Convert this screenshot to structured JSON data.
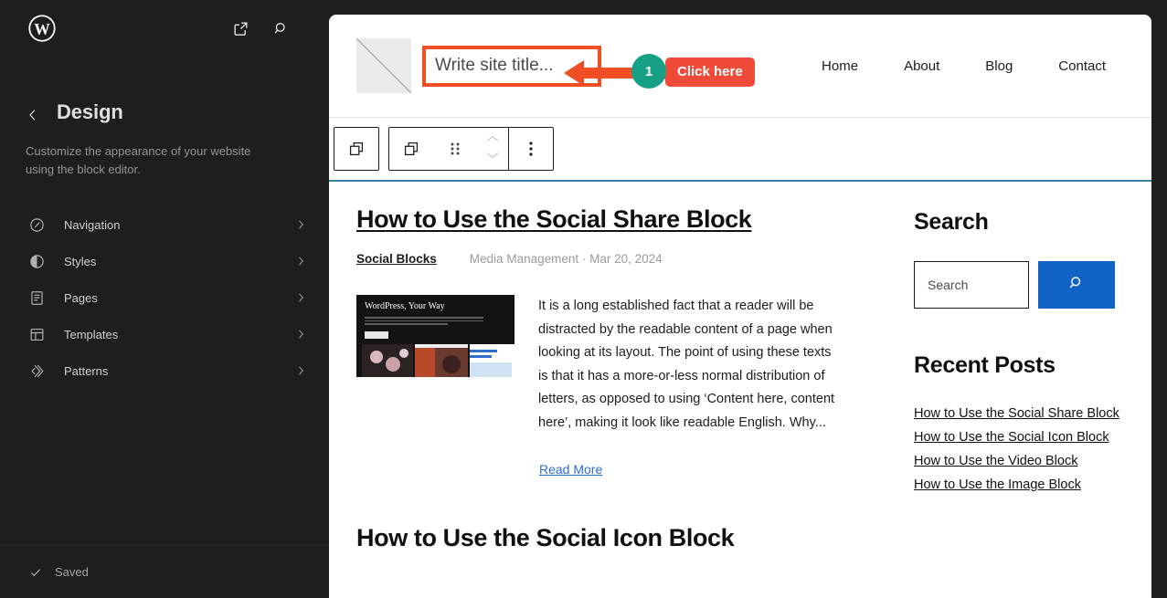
{
  "sidebar": {
    "logo_icon": "wordpress-logo",
    "top_icons": [
      {
        "name": "view-site-icon",
        "label": "View site"
      },
      {
        "name": "search-icon",
        "label": "Search"
      }
    ],
    "back_label": "Back",
    "title": "Design",
    "description": "Customize the appearance of your website using the block editor.",
    "items": [
      {
        "label": "Navigation",
        "icon": "navigation-icon"
      },
      {
        "label": "Styles",
        "icon": "styles-contrast-icon"
      },
      {
        "label": "Pages",
        "icon": "pages-document-icon"
      },
      {
        "label": "Templates",
        "icon": "templates-layout-icon"
      },
      {
        "label": "Patterns",
        "icon": "patterns-stack-icon"
      }
    ],
    "footer": {
      "status": "Saved",
      "icon": "check-icon"
    }
  },
  "site_header": {
    "logo_placeholder": "site-logo-placeholder",
    "site_title_placeholder": "Write site title...",
    "nav": [
      "Home",
      "About",
      "Blog",
      "Contact"
    ]
  },
  "annotation": {
    "step_number": "1",
    "callout_label": "Click here",
    "badge_color": "#16a085",
    "callout_color": "#ef4b38",
    "arrow_color": "#f04e23",
    "highlight_border_color": "#f04e23"
  },
  "block_toolbar": {
    "buttons": [
      {
        "name": "select-parent-block-button",
        "icon": "block-copy-icon"
      },
      {
        "name": "block-type-button",
        "icon": "block-copy-icon"
      },
      {
        "name": "drag-handle",
        "icon": "drag-dots-icon"
      },
      {
        "name": "move-up-button",
        "icon": "chevron-up-icon"
      },
      {
        "name": "move-down-button",
        "icon": "chevron-down-icon"
      },
      {
        "name": "more-options-button",
        "icon": "vertical-dots-icon"
      }
    ]
  },
  "content": {
    "post": {
      "title": "How to Use the Social Share Block",
      "category": "Social Blocks",
      "meta": "Media Management · Mar 20, 2024",
      "thumbnail_title": "WordPress, Your Way",
      "excerpt": "It is a long established fact that a reader will be distracted by the readable content of a page when looking at its layout. The point of using these texts is that it has a more-or-less normal distribution of letters, as opposed to using ‘Content here, content here’, making it look like readable English. Why...",
      "read_more": "Read More"
    },
    "next_post_title": "How to Use the Social Icon Block"
  },
  "widgets": {
    "search": {
      "heading": "Search",
      "field_placeholder": "Search",
      "button_icon": "search-icon",
      "button_color": "#1062c4"
    },
    "recent_posts": {
      "heading": "Recent Posts",
      "items": [
        "How to Use the Social Share Block",
        "How to Use the Social Icon Block",
        "How to Use the Video Block",
        "How to Use the Image Block"
      ]
    }
  }
}
